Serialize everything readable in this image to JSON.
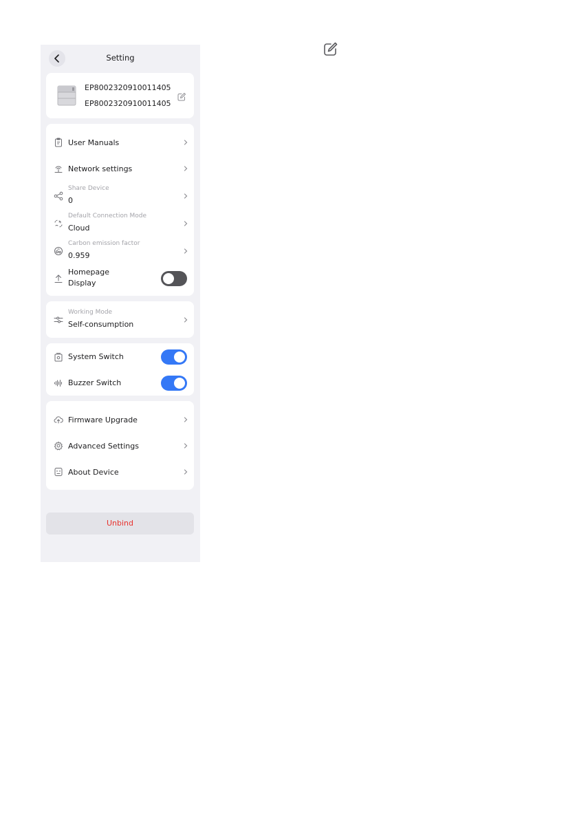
{
  "header": {
    "title": "Setting"
  },
  "device": {
    "name": "EP8002320910011405",
    "serial": "EP8002320910011405"
  },
  "settings_list": {
    "user_manuals": {
      "label": "User Manuals",
      "icon": "clipboard-icon"
    },
    "network_settings": {
      "label": "Network settings",
      "icon": "wifi-router-icon"
    },
    "share_device": {
      "label": "Share Device",
      "value": "0",
      "icon": "share-icon"
    },
    "connection_mode": {
      "label": "Default Connection Mode",
      "value": "Cloud",
      "icon": "connection-icon"
    },
    "carbon_factor": {
      "label": "Carbon emission factor",
      "value": "0.959",
      "icon": "carbon-icon"
    },
    "homepage_display": {
      "label_line1": "Homepage",
      "label_line2": "Display",
      "enabled": false,
      "icon": "upload-icon"
    }
  },
  "working_mode": {
    "label": "Working Mode",
    "value": "Self-consumption",
    "icon": "sliders-icon"
  },
  "switches": {
    "system_switch": {
      "label": "System Switch",
      "enabled": true,
      "icon": "system-switch-icon"
    },
    "buzzer_switch": {
      "label": "Buzzer Switch",
      "enabled": true,
      "icon": "sound-wave-icon"
    }
  },
  "device_list": {
    "firmware_upgrade": {
      "label": "Firmware Upgrade",
      "icon": "cloud-upload-icon"
    },
    "advanced_settings": {
      "label": "Advanced Settings",
      "icon": "gear-icon"
    },
    "about_device": {
      "label": "About Device",
      "icon": "device-info-icon"
    }
  },
  "unbind": {
    "label": "Unbind"
  },
  "colors": {
    "background": "#f1f1f5",
    "card": "#ffffff",
    "accent": "#3478f6",
    "toggle_off": "#545458",
    "danger": "#e8302b",
    "muted": "#a3a3a9"
  }
}
